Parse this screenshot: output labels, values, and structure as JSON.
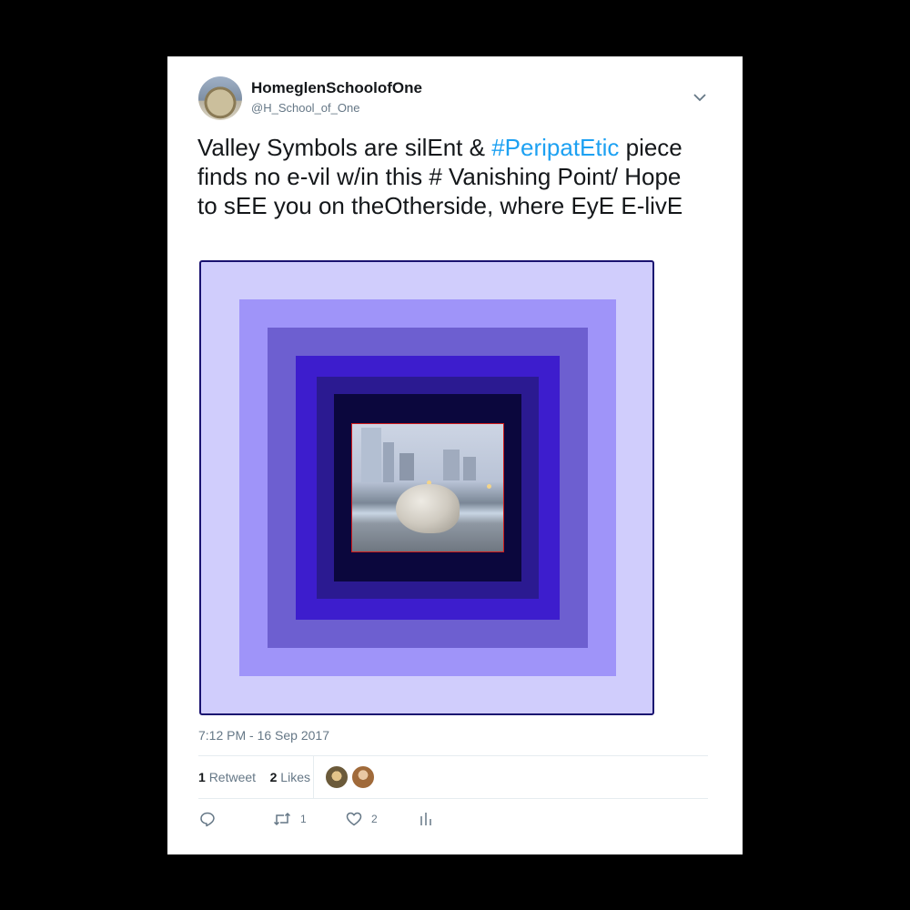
{
  "user": {
    "display_name": "HomeglenSchoolofOne",
    "handle": "@H_School_of_One"
  },
  "tweet": {
    "text_before": "Valley Symbols are silEnt & ",
    "hashtag": "#PeripatEtic",
    "text_after": " piece finds no e-vil w/in this # Vanishing Point/ Hope to sEE you on theOtherside, where EyE E-livE",
    "timestamp": "7:12 PM - 16 Sep 2017"
  },
  "stats": {
    "retweet_count": "1",
    "retweet_label": "Retweet",
    "like_count": "2",
    "like_label": "Likes"
  },
  "actions": {
    "reply_count": "",
    "retweet_count": "1",
    "like_count": "2"
  },
  "colors": {
    "hashtag": "#1da1f2",
    "media_outer": "#d0cdfc",
    "media_frame": "#1a1270",
    "photo_border": "#d01b1b"
  },
  "icons": [
    "chevron-down-icon",
    "reply-icon",
    "retweet-icon",
    "heart-icon",
    "analytics-icon"
  ]
}
